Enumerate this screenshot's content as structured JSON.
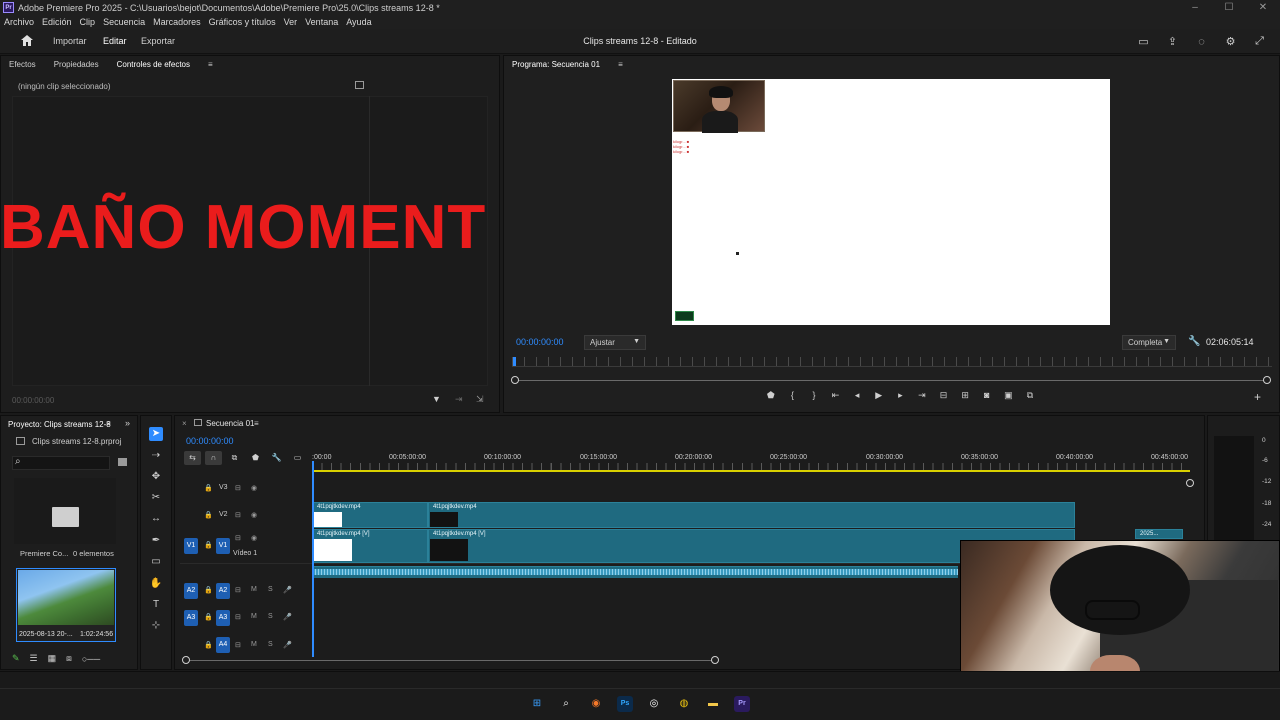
{
  "window": {
    "title": "Adobe Premiere Pro 2025 - C:\\Usuarios\\bejot\\Documentos\\Adobe\\Premiere Pro\\25.0\\Clips streams 12-8 *",
    "app_logo": "Pr",
    "controls": [
      "–",
      "☐",
      "✕"
    ]
  },
  "menu": [
    "Archivo",
    "Edición",
    "Clip",
    "Secuencia",
    "Marcadores",
    "Gráficos y títulos",
    "Ver",
    "Ventana",
    "Ayuda"
  ],
  "header": {
    "tabs": [
      "Importar",
      "Editar",
      "Exportar"
    ],
    "active_tab": "Editar",
    "project_title": "Clips streams 12-8 - Editado"
  },
  "effects_panel": {
    "tabs": [
      "Efectos",
      "Propiedades",
      "Controles de efectos"
    ],
    "active_tab": "Controles de efectos",
    "empty_message": "(ningún clip seleccionado)",
    "overlay_text": "BAÑO MOMENT",
    "timecode": "00:00:00:00",
    "overlay_color": "#ea1c1c"
  },
  "program_monitor": {
    "title": "Programa: Secuencia 01",
    "timecode": "00:00:00:00",
    "fit": "Ajustar",
    "quality": "Completa",
    "duration": "02:06:05:14",
    "chat_lines": [
      "kilogr... ■",
      "kilogr... ■",
      "kilogr... ■"
    ]
  },
  "project_panel": {
    "title": "Proyecto: Clips streams 12-8",
    "file": "Clips streams 12-8.prproj",
    "folder_name": "Premiere Co...",
    "folder_count": "0 elementos",
    "clip_name": "2025-08-13 20-...",
    "clip_duration": "1:02:24:56"
  },
  "timeline": {
    "sequence_tab": "Secuencia 01",
    "timecode": "00:00:00:00",
    "ruler": [
      ":00:00",
      "00:05:00:00",
      "00:10:00:00",
      "00:15:00:00",
      "00:20:00:00",
      "00:25:00:00",
      "00:30:00:00",
      "00:35:00:00",
      "00:40:00:00",
      "00:45:00:00"
    ],
    "tracks": {
      "v3": "V3",
      "v2": "V2",
      "v1": "V1",
      "v1_name": "Vídeo 1",
      "a2": "A2",
      "a3": "A3",
      "a4": "A4",
      "mute": "M",
      "solo": "S"
    },
    "clips": {
      "v2_a": "4t1pqjtkdev.mp4",
      "v2_b": "4t1pqjtkdev.mp4",
      "v1_a": "4t1pqjtkdev.mp4 [V]",
      "v1_b": "4t1pqjtkdev.mp4 [V]",
      "v1_c": "2025..."
    },
    "accent": "#2f8cff",
    "clip_color": "#1f6a80"
  },
  "audio_meters": [
    "0",
    "-6",
    "-12",
    "-18",
    "-24"
  ],
  "taskbar": [
    "windows-start",
    "search",
    "blender",
    "photoshop",
    "obs",
    "chrome",
    "file-explorer",
    "premiere"
  ]
}
